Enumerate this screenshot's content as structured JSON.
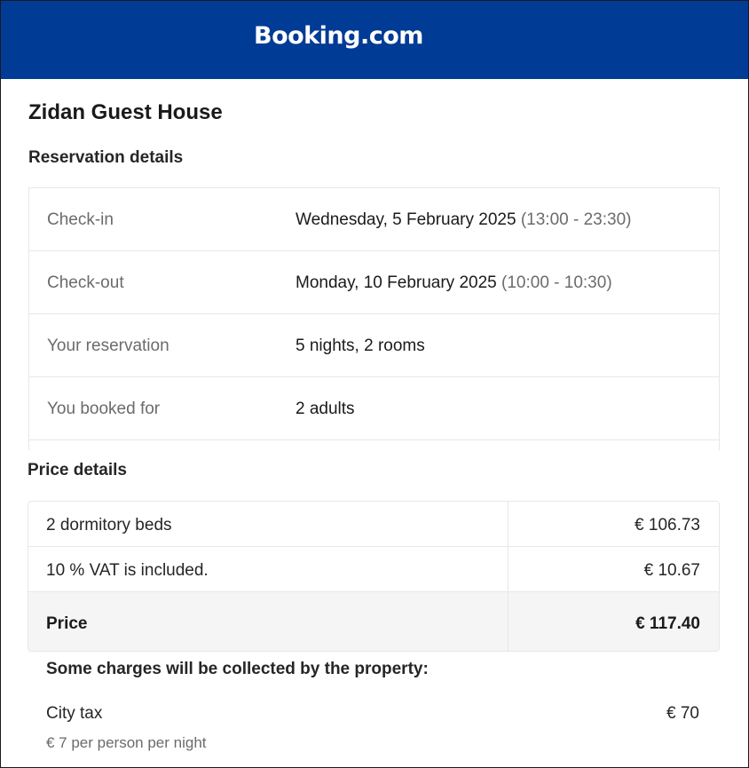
{
  "brand": {
    "name": "Booking.com",
    "color": "#003b95"
  },
  "hotel": {
    "name": "Zidan Guest House"
  },
  "reservation": {
    "title": "Reservation details",
    "rows": [
      {
        "label": "Check-in",
        "value": "Wednesday, 5 February 2025",
        "note": "(13:00 - 23:30)"
      },
      {
        "label": "Check-out",
        "value": "Monday, 10 February 2025",
        "note": "(10:00 - 10:30)"
      },
      {
        "label": "Your reservation",
        "value": "5 nights, 2 rooms",
        "note": ""
      },
      {
        "label": "You booked for",
        "value": "2 adults",
        "note": ""
      }
    ]
  },
  "price": {
    "title": "Price details",
    "rows": [
      {
        "label": "2 dormitory beds",
        "value": "€ 106.73"
      },
      {
        "label": "10 % VAT is included.",
        "value": "€ 10.67"
      }
    ],
    "total": {
      "label": "Price",
      "value": "€ 117.40"
    }
  },
  "property_charges": {
    "title": "Some charges will be collected by the property:",
    "items": [
      {
        "label": "City tax",
        "value": "€ 70",
        "note": "€ 7 per person per night"
      }
    ]
  }
}
